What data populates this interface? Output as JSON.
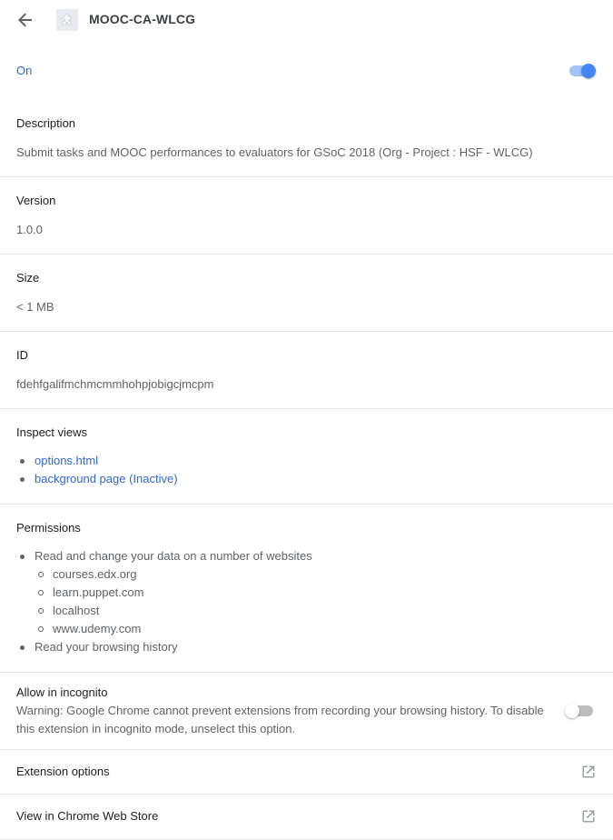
{
  "header": {
    "title": "MOOC-CA-WLCG",
    "back_icon": "arrow-left-icon",
    "extension_icon": "puzzle-piece-icon"
  },
  "status": {
    "label": "On",
    "enabled": true,
    "accent_color": "#4285f4"
  },
  "description": {
    "label": "Description",
    "value": "Submit tasks and MOOC performances to evaluators for GSoC 2018 (Org - Project : HSF - WLCG)"
  },
  "version": {
    "label": "Version",
    "value": "1.0.0"
  },
  "size": {
    "label": "Size",
    "value": "< 1 MB"
  },
  "id": {
    "label": "ID",
    "value": "fdehfgalifmchmcmmhohpjobigcjmcpm"
  },
  "inspect_views": {
    "label": "Inspect views",
    "items": [
      "options.html",
      "background page (Inactive)"
    ]
  },
  "permissions": {
    "label": "Permissions",
    "items": [
      {
        "text": "Read and change your data on a number of websites",
        "sites": [
          "courses.edx.org",
          "learn.puppet.com",
          "localhost",
          "www.udemy.com"
        ]
      },
      {
        "text": "Read your browsing history"
      }
    ]
  },
  "incognito": {
    "label": "Allow in incognito",
    "warning": "Warning: Google Chrome cannot prevent extensions from recording your browsing history. To disable this extension in incognito mode, unselect this option.",
    "enabled": false
  },
  "extension_options": {
    "label": "Extension options",
    "icon": "open-in-new-icon"
  },
  "web_store": {
    "label": "View in Chrome Web Store",
    "icon": "open-in-new-icon"
  }
}
